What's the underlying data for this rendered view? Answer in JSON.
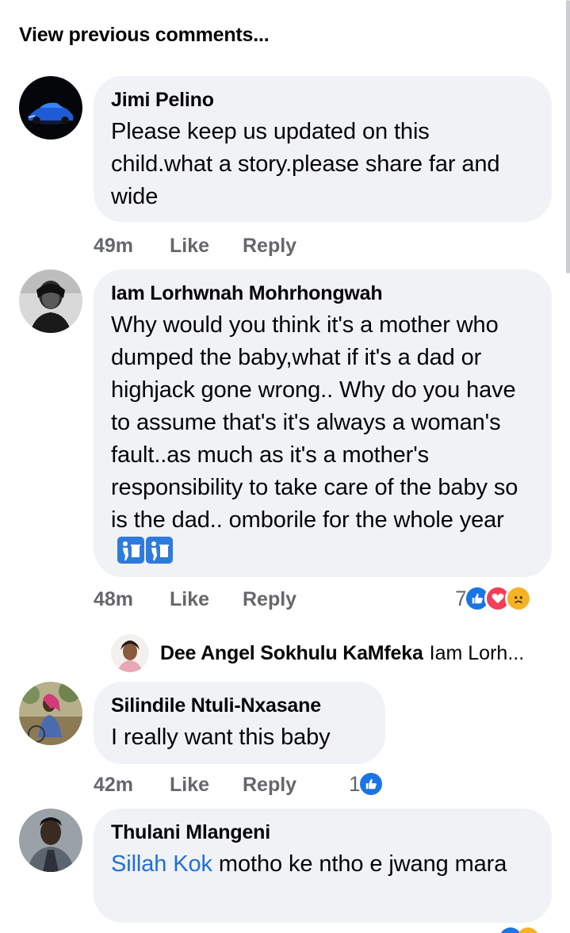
{
  "view_previous": "View previous comments...",
  "comments": [
    {
      "author": "Jimi Pelino",
      "text": "Please keep us updated on this child.what a story.please share far and wide",
      "time": "49m",
      "like": "Like",
      "reply": "Reply"
    },
    {
      "author": "Iam Lorhwnah Mohrhongwah",
      "text": "Why would you think it's a mother who dumped the baby,what if it's a dad or highjack gone wrong.. Why do you have to assume that's it's always a woman's fault..as much as it's a mother's responsibility to take care of the baby so is the dad.. omborile for the whole year",
      "time": "48m",
      "like": "Like",
      "reply": "Reply",
      "reaction_count": "7",
      "reactions": [
        "like-icon",
        "love-icon",
        "sad-icon"
      ],
      "emoji": [
        "wastebasket-emoji",
        "wastebasket-emoji"
      ]
    },
    {
      "author": "Silindile Ntuli-Nxasane",
      "text": "I really want this baby",
      "time": "42m",
      "like": "Like",
      "reply": "Reply",
      "reaction_count": "1",
      "reactions": [
        "like-icon"
      ]
    },
    {
      "author": "Thulani Mlangeni",
      "mention": "Sillah Kok",
      "text": " motho ke ntho e jwang mara"
    }
  ],
  "nested_reply": {
    "author": "Dee Angel Sokhulu KaMfeka",
    "snippet": "Iam Lorh..."
  },
  "colors": {
    "bubble": "#f0f2f5",
    "meta": "#65676b",
    "mention": "#216fdb",
    "like": "#1b74e4",
    "love": "#f33e58",
    "sad": "#f7b125"
  }
}
